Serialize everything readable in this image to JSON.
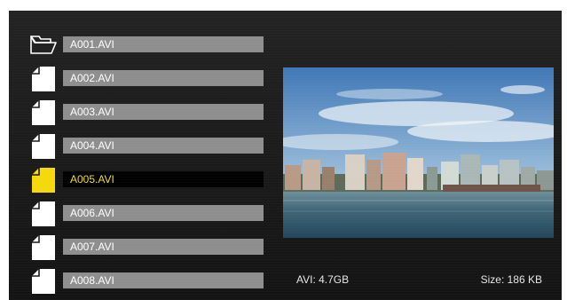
{
  "file_list": {
    "items": [
      {
        "name": "A001.AVI",
        "icon": "folder-icon",
        "selected": false
      },
      {
        "name": "A002.AVI",
        "icon": "file-icon",
        "selected": false
      },
      {
        "name": "A003.AVI",
        "icon": "file-icon",
        "selected": false
      },
      {
        "name": "A004.AVI",
        "icon": "file-icon",
        "selected": false
      },
      {
        "name": "A005.AVI",
        "icon": "file-icon",
        "selected": true
      },
      {
        "name": "A006.AVI",
        "icon": "file-icon",
        "selected": false
      },
      {
        "name": "A007.AVI",
        "icon": "file-icon",
        "selected": false
      },
      {
        "name": "A008.AVI",
        "icon": "file-icon",
        "selected": false
      }
    ]
  },
  "preview": {
    "image_subject": "city waterfront with buildings under a blue sky with clouds"
  },
  "info": {
    "left": "AVI: 4.7GB",
    "right": "Size: 186 KB"
  },
  "colors": {
    "background": "#1c1c1c",
    "bar": "#8e8e8e",
    "selected_bar": "#000000",
    "selected_text": "#f0dc1e",
    "selected_icon": "#f5d90a",
    "icon": "#ffffff"
  }
}
